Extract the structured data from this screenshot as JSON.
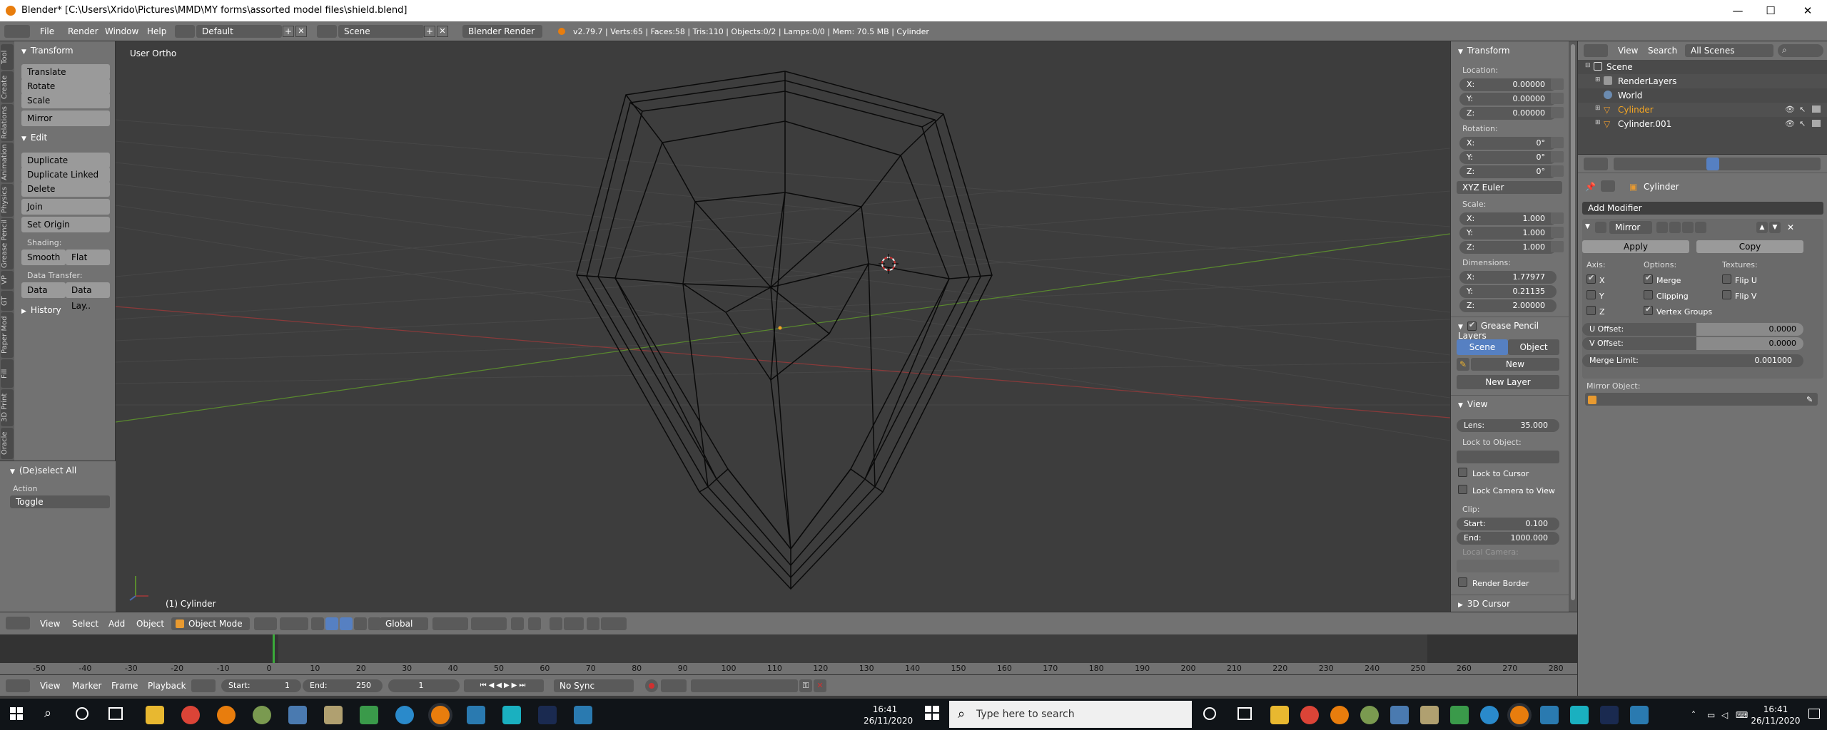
{
  "window": {
    "title": "Blender* [C:\\Users\\Xrido\\Pictures\\MMD\\MY forms\\assorted model files\\shield.blend]"
  },
  "menu": {
    "file": "File",
    "render": "Render",
    "window": "Window",
    "help": "Help"
  },
  "info": {
    "layout": "Default",
    "scene": "Scene",
    "engine": "Blender Render",
    "stats": "v2.79.7 | Verts:65 | Faces:58 | Tris:110 | Objects:0/2 | Lamps:0/0 | Mem: 70.5 MB | Cylinder"
  },
  "viewport": {
    "view_name": "User Ortho",
    "object_label": "(1) Cylinder"
  },
  "tool_shelf": {
    "tabs": [
      "Tool",
      "Create",
      "Relations",
      "Animation",
      "Physics",
      "Grease Pencil",
      "VP",
      "GT",
      "Paper Mod",
      "Fill",
      "3D Print",
      "Oracle"
    ],
    "transform_title": "Transform",
    "translate": "Translate",
    "rotate": "Rotate",
    "scale": "Scale",
    "mirror": "Mirror",
    "edit_title": "Edit",
    "duplicate": "Duplicate",
    "duplicate_linked": "Duplicate Linked",
    "delete": "Delete",
    "join": "Join",
    "set_origin": "Set Origin",
    "shading_label": "Shading:",
    "smooth": "Smooth",
    "flat": "Flat",
    "data_transfer_label": "Data Transfer:",
    "data": "Data",
    "data_lay": "Data Lay..",
    "history": "History"
  },
  "operator_panel": {
    "title": "(De)select All",
    "action_label": "Action",
    "action_value": "Toggle"
  },
  "properties_region": {
    "transform_title": "Transform",
    "location_label": "Location:",
    "loc_x": "X:",
    "loc_x_val": "0.00000",
    "loc_y": "Y:",
    "loc_y_val": "0.00000",
    "loc_z": "Z:",
    "loc_z_val": "0.00000",
    "rotation_label": "Rotation:",
    "rot_x": "X:",
    "rot_x_val": "0°",
    "rot_y": "Y:",
    "rot_y_val": "0°",
    "rot_z": "Z:",
    "rot_z_val": "0°",
    "rotation_mode": "XYZ Euler",
    "scale_label": "Scale:",
    "scl_x": "X:",
    "scl_x_val": "1.000",
    "scl_y": "Y:",
    "scl_y_val": "1.000",
    "scl_z": "Z:",
    "scl_z_val": "1.000",
    "dimensions_label": "Dimensions:",
    "dim_x": "X:",
    "dim_x_val": "1.77977",
    "dim_y": "Y:",
    "dim_y_val": "0.21135",
    "dim_z": "Z:",
    "dim_z_val": "2.00000",
    "gp_title": "Grease Pencil Layers",
    "gp_scene": "Scene",
    "gp_object": "Object",
    "gp_new": "New",
    "gp_new_layer": "New Layer",
    "view_title": "View",
    "lens_label": "Lens:",
    "lens_val": "35.000",
    "lock_obj_label": "Lock to Object:",
    "lock_cursor": "Lock to Cursor",
    "lock_camera": "Lock Camera to View",
    "clip_label": "Clip:",
    "clip_start": "Start:",
    "clip_start_val": "0.100",
    "clip_end": "End:",
    "clip_end_val": "1000.000",
    "local_camera": "Local Camera:",
    "render_border": "Render Border",
    "cursor_title": "3D Cursor"
  },
  "view3d_header": {
    "view": "View",
    "select": "Select",
    "add": "Add",
    "object": "Object",
    "mode": "Object Mode",
    "orientation": "Global"
  },
  "timeline": {
    "ticks": [
      "-50",
      "-40",
      "-30",
      "-20",
      "-10",
      "0",
      "10",
      "20",
      "30",
      "40",
      "50",
      "60",
      "70",
      "80",
      "90",
      "100",
      "110",
      "120",
      "130",
      "140",
      "150",
      "160",
      "170",
      "180",
      "190",
      "200",
      "210",
      "220",
      "230",
      "240",
      "250",
      "260",
      "270",
      "280"
    ],
    "view": "View",
    "marker": "Marker",
    "frame": "Frame",
    "playback": "Playback",
    "start_label": "Start:",
    "start_val": "1",
    "end_label": "End:",
    "end_val": "250",
    "current": "1",
    "sync": "No Sync"
  },
  "outliner": {
    "view": "View",
    "search": "Search",
    "scenes_filter": "All Scenes",
    "items": [
      "Scene",
      "RenderLayers",
      "World",
      "Cylinder",
      "Cylinder.001"
    ]
  },
  "properties": {
    "object_name": "Cylinder",
    "add_modifier": "Add Modifier",
    "modifier_name": "Mirror",
    "apply": "Apply",
    "copy": "Copy",
    "axis_label": "Axis:",
    "options_label": "Options:",
    "textures_label": "Textures:",
    "axis_x": "X",
    "axis_y": "Y",
    "axis_z": "Z",
    "merge": "Merge",
    "clipping": "Clipping",
    "vertex_groups": "Vertex Groups",
    "flip_u": "Flip U",
    "flip_v": "Flip V",
    "u_offset": "U Offset:",
    "u_offset_val": "0.0000",
    "v_offset": "V Offset:",
    "v_offset_val": "0.0000",
    "merge_limit": "Merge Limit:",
    "merge_limit_val": "0.001000",
    "mirror_object": "Mirror Object:"
  },
  "taskbar": {
    "search_placeholder": "Type here to search",
    "time_left": "16:41",
    "date_left": "26/11/2020",
    "time_right": "16:41",
    "date_right": "26/11/2020"
  },
  "colors": {
    "accent_blue": "#5680c2",
    "x_axis": "#8b3a3a",
    "y_axis": "#5a8a2e",
    "panel_bg": "#727272",
    "viewport_bg": "#3d3d3d"
  }
}
